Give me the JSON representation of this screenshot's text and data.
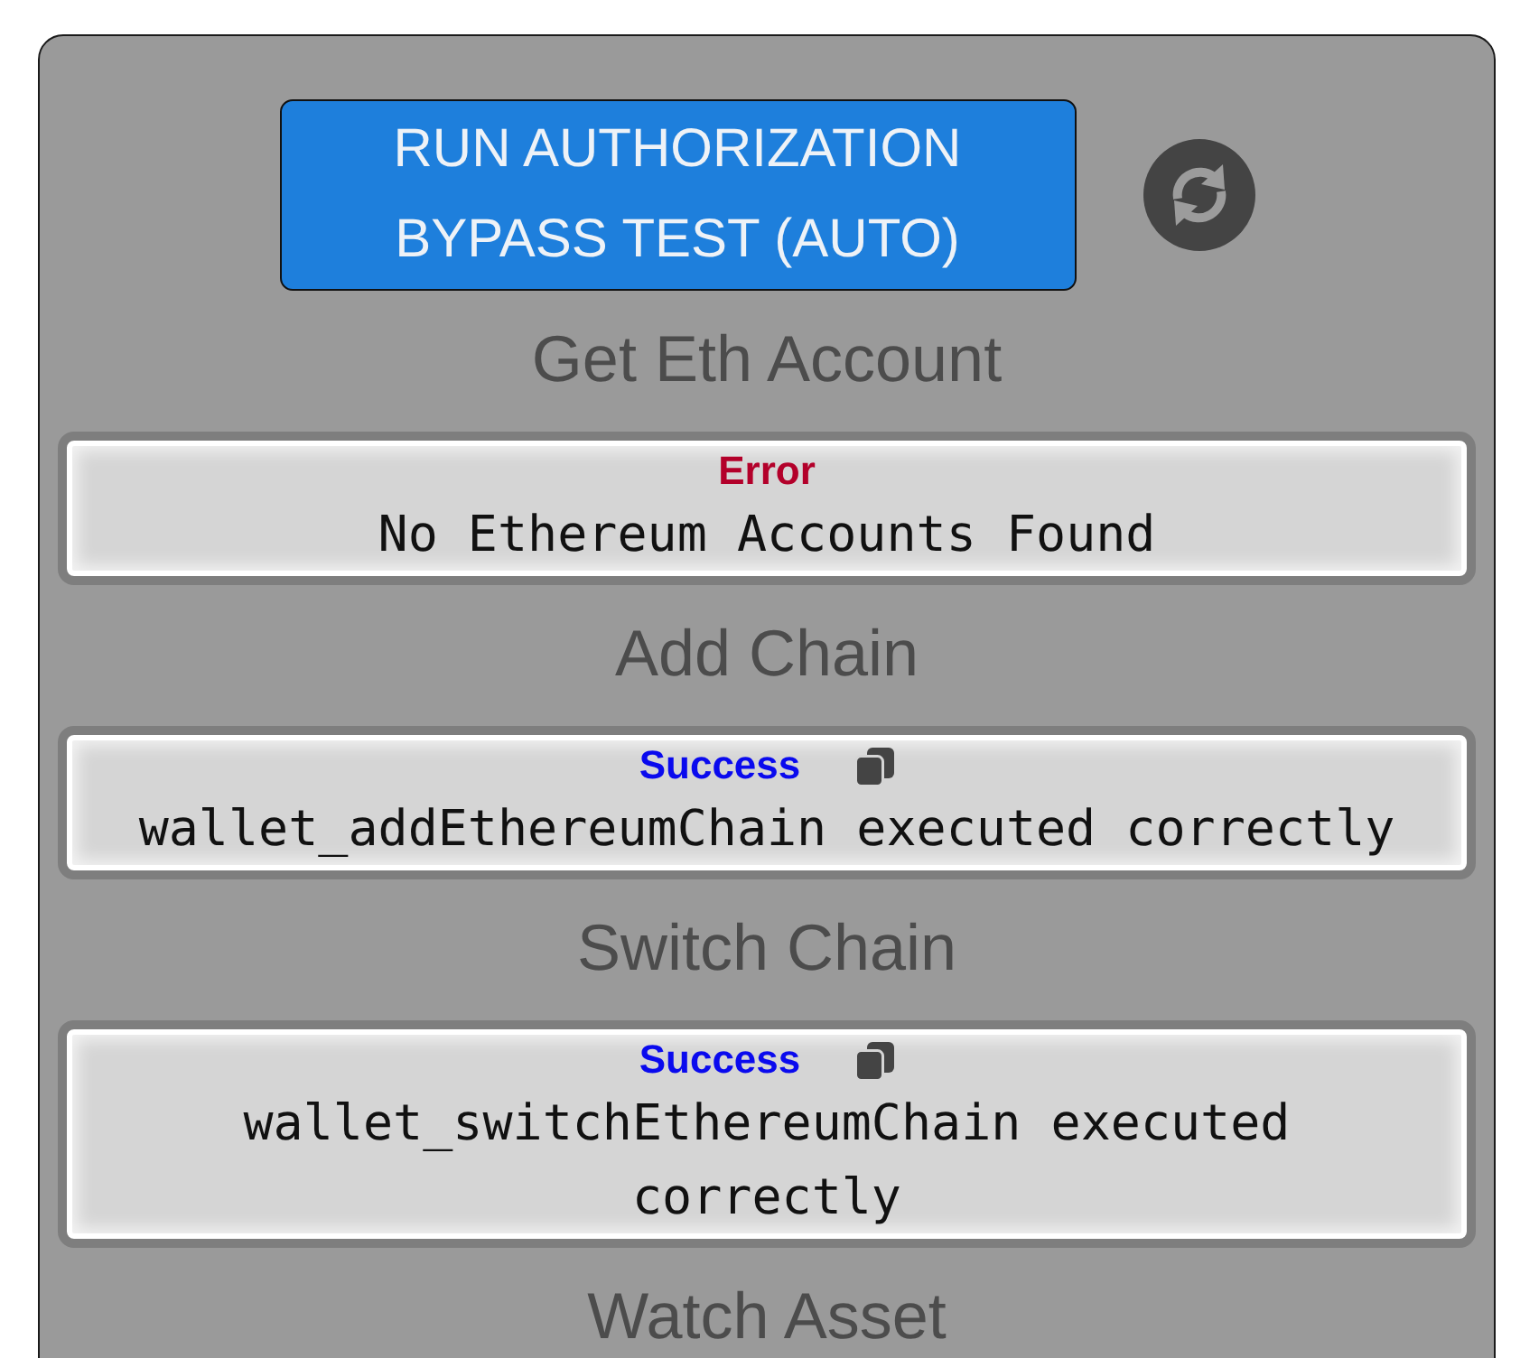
{
  "action_button": {
    "label": "RUN AUTHORIZATION BYPASS TEST (AUTO)"
  },
  "sections": [
    {
      "heading": "Get Eth Account",
      "result": {
        "kind": "error",
        "title": "Error",
        "copyable": false,
        "message": "No Ethereum Accounts Found"
      }
    },
    {
      "heading": "Add Chain",
      "result": {
        "kind": "success",
        "title": "Success",
        "copyable": true,
        "message": "wallet_addEthereumChain executed correctly"
      }
    },
    {
      "heading": "Switch Chain",
      "result": {
        "kind": "success",
        "title": "Success",
        "copyable": true,
        "message": "wallet_switchEthereumChain executed correctly"
      }
    },
    {
      "heading": "Watch Asset"
    }
  ]
}
